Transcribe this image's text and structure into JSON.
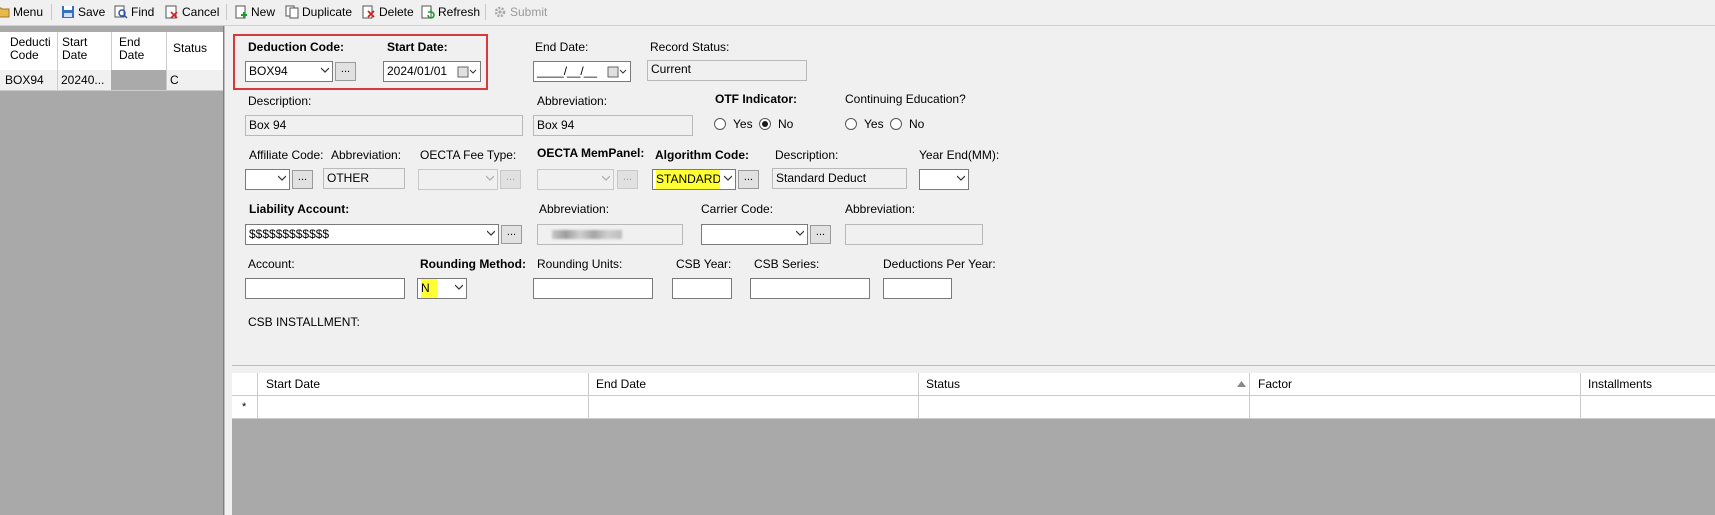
{
  "toolbar": {
    "menu": "Menu",
    "save": "Save",
    "find": "Find",
    "cancel": "Cancel",
    "new": "New",
    "duplicate": "Duplicate",
    "delete": "Delete",
    "refresh": "Refresh",
    "submit": "Submit"
  },
  "list": {
    "headers": {
      "code": "Deducti Code",
      "start": "Start Date",
      "end": "End Date",
      "status": "Status"
    },
    "row": {
      "code": "BOX94",
      "start": "20240...",
      "end": "",
      "status": "C"
    }
  },
  "form": {
    "deduction_code_label": "Deduction Code:",
    "deduction_code_value": "BOX94",
    "start_date_label": "Start Date:",
    "start_date_value": "2024/01/01",
    "end_date_label": "End Date:",
    "end_date_value": "____/__/__",
    "record_status_label": "Record Status:",
    "record_status_value": "Current",
    "description_label": "Description:",
    "description_value": "Box 94",
    "abbreviation_label": "Abbreviation:",
    "abbreviation_value": "Box 94",
    "otf_label": "OTF Indicator:",
    "otf_yes": "Yes",
    "otf_no": "No",
    "cont_ed_label": "Continuing Education?",
    "cont_ed_yes": "Yes",
    "cont_ed_no": "No",
    "affiliate_label": "Affiliate Code:",
    "affiliate_abbr_label": "Abbreviation:",
    "affiliate_abbr_value": "OTHER",
    "oecta_fee_label": "OECTA Fee Type:",
    "oecta_mem_label": "OECTA MemPanel:",
    "algorithm_label": "Algorithm Code:",
    "algorithm_value": "STANDARD",
    "algorithm_desc_label": "Description:",
    "algorithm_desc_value": "Standard Deduct",
    "year_end_label": "Year End(MM):",
    "liability_label": "Liability Account:",
    "liability_value": "$$$$$$$$$$$$",
    "liability_abbr_label": "Abbreviation:",
    "carrier_label": "Carrier Code:",
    "carrier_abbr_label": "Abbreviation:",
    "account_label": "Account:",
    "rounding_method_label": "Rounding Method:",
    "rounding_method_value": "N",
    "rounding_units_label": "Rounding Units:",
    "csb_year_label": "CSB Year:",
    "csb_series_label": "CSB Series:",
    "deductions_per_year_label": "Deductions Per Year:",
    "csb_installment_label": "CSB INSTALLMENT:"
  },
  "installments_grid": {
    "columns": [
      "Start Date",
      "End Date",
      "Status",
      "Factor",
      "Installments"
    ],
    "new_row_marker": "*"
  },
  "colors": {
    "highlight": "#ffff33",
    "focus_box": "#d83a3a",
    "grid_bg": "#a9a9a9"
  }
}
